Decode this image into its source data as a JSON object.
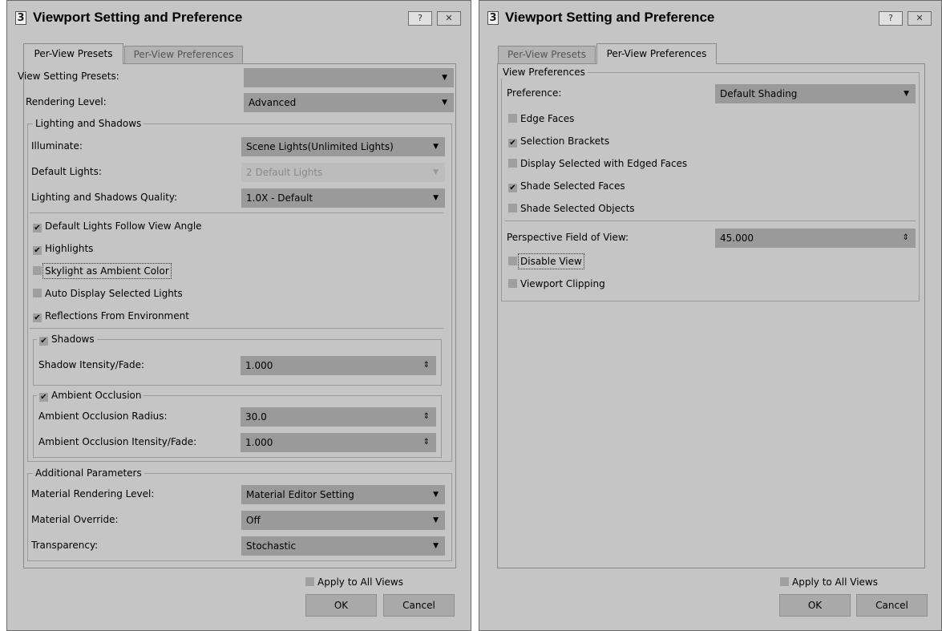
{
  "dialog_left": {
    "title": "Viewport Setting and Preference",
    "title_buttons": {
      "help": "?",
      "close": "✕"
    },
    "tabs": [
      {
        "label": "Per-View Presets",
        "active": true
      },
      {
        "label": "Per-View Preferences",
        "active": false
      }
    ],
    "view_setting_presets": {
      "label": "View Setting Presets:",
      "value": ""
    },
    "rendering_level": {
      "label": "Rendering Level:",
      "value": "Advanced"
    },
    "lighting_shadows": {
      "group_label": "Lighting and Shadows",
      "illuminate": {
        "label": "Illuminate:",
        "value": "Scene Lights(Unlimited Lights)"
      },
      "default_lights": {
        "label": "Default Lights:",
        "value": "2 Default Lights",
        "disabled": true
      },
      "quality": {
        "label": "Lighting and Shadows Quality:",
        "value": "1.0X - Default"
      },
      "checks": [
        {
          "label": "Default Lights Follow View Angle",
          "checked": true
        },
        {
          "label": "Highlights",
          "checked": true
        },
        {
          "label": "Skylight as Ambient Color",
          "checked": false
        },
        {
          "label": "Auto Display Selected Lights",
          "checked": false
        },
        {
          "label": "Reflections From Environment",
          "checked": true
        }
      ],
      "shadows": {
        "label": "Shadows",
        "checked": true,
        "intensity_label": "Shadow Itensity/Fade:",
        "intensity_value": "1.000"
      },
      "ambient_occlusion": {
        "label": "Ambient Occlusion",
        "checked": true,
        "radius_label": "Ambient Occlusion Radius:",
        "radius_value": "30.0",
        "intensity_label": "Ambient Occlusion Itensity/Fade:",
        "intensity_value": "1.000"
      }
    },
    "additional": {
      "group_label": "Additional Parameters",
      "material_rendering_level": {
        "label": "Material Rendering Level:",
        "value": "Material Editor Setting"
      },
      "material_override": {
        "label": "Material Override:",
        "value": "Off"
      },
      "transparency": {
        "label": "Transparency:",
        "value": "Stochastic"
      }
    },
    "apply_all": {
      "label": "Apply to All Views",
      "checked": false
    },
    "ok_label": "OK",
    "cancel_label": "Cancel"
  },
  "dialog_right": {
    "title": "Viewport Setting and Preference",
    "title_buttons": {
      "help": "?",
      "close": "✕"
    },
    "tabs": [
      {
        "label": "Per-View Presets",
        "active": false
      },
      {
        "label": "Per-View Preferences",
        "active": true
      }
    ],
    "view_preferences": {
      "group_label": "View Preferences",
      "preference": {
        "label": "Preference:",
        "value": "Default Shading"
      },
      "checks": [
        {
          "label": "Edge Faces",
          "checked": false
        },
        {
          "label": "Selection Brackets",
          "checked": true
        },
        {
          "label": "Display Selected with Edged Faces",
          "checked": false
        },
        {
          "label": "Shade Selected Faces",
          "checked": true
        },
        {
          "label": "Shade Selected Objects",
          "checked": false
        }
      ],
      "perspective_fov": {
        "label": "Perspective Field of View:",
        "value": "45.000"
      },
      "disable_view": {
        "label": "Disable View",
        "checked": false
      },
      "viewport_clipping": {
        "label": "Viewport Clipping",
        "checked": false
      }
    },
    "apply_all": {
      "label": "Apply to All Views",
      "checked": false
    },
    "ok_label": "OK",
    "cancel_label": "Cancel"
  },
  "icons": {
    "dropdown_arrow": "▼",
    "spinner_arrow": "⇕",
    "check": "✔"
  }
}
